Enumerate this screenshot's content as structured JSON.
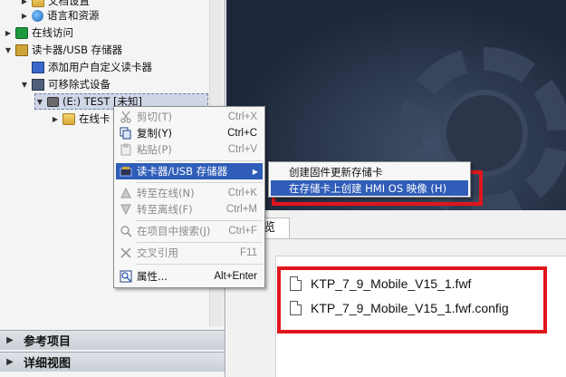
{
  "tree": {
    "items": [
      {
        "label": "文档设置",
        "indent": 1
      },
      {
        "label": "语言和资源",
        "indent": 1
      },
      {
        "label": "在线访问",
        "indent": 0
      },
      {
        "label": "读卡器/USB 存储器",
        "indent": 0
      },
      {
        "label": "添加用户自定义读卡器",
        "indent": 1
      },
      {
        "label": "可移除式设备",
        "indent": 1
      },
      {
        "label": "(E:) TEST [未知]",
        "indent": 2
      },
      {
        "label": "在线卡",
        "indent": 3
      }
    ]
  },
  "bottom_panels": {
    "reference": "参考项目",
    "details": "详细视图"
  },
  "overview_tab": "览",
  "context_menu": {
    "items": [
      {
        "label": "剪切(T)",
        "shortcut": "Ctrl+X",
        "icon": "scissors-icon",
        "enabled": false
      },
      {
        "label": "复制(Y)",
        "shortcut": "Ctrl+C",
        "icon": "copy-icon",
        "enabled": true
      },
      {
        "label": "粘贴(P)",
        "shortcut": "Ctrl+V",
        "icon": "paste-icon",
        "enabled": false
      },
      {
        "label": "读卡器/USB 存储器",
        "shortcut": "",
        "icon": "card-reader-icon",
        "enabled": true,
        "submenu": true
      },
      {
        "label": "转至在线(N)",
        "shortcut": "Ctrl+K",
        "icon": "go-online-icon",
        "enabled": false
      },
      {
        "label": "转至离线(F)",
        "shortcut": "Ctrl+M",
        "icon": "go-offline-icon",
        "enabled": false
      },
      {
        "label": "在项目中搜索(J)",
        "shortcut": "Ctrl+F",
        "icon": "search-icon",
        "enabled": false
      },
      {
        "label": "交叉引用",
        "shortcut": "F11",
        "icon": "cross-reference-icon",
        "enabled": false
      },
      {
        "label": "属性...",
        "shortcut": "Alt+Enter",
        "icon": "properties-icon",
        "enabled": true
      }
    ]
  },
  "submenu": {
    "items": [
      {
        "label": "创建固件更新存储卡"
      },
      {
        "label": "在存储卡上创建 HMI OS 映像 (H)"
      }
    ]
  },
  "files": [
    {
      "name": "KTP_7_9_Mobile_V15_1.fwf"
    },
    {
      "name": "KTP_7_9_Mobile_V15_1.fwf.config"
    }
  ],
  "colors": {
    "highlight": "#2f5db8",
    "annotation_red": "#e0161d",
    "banner_dark": "#1d273a"
  }
}
